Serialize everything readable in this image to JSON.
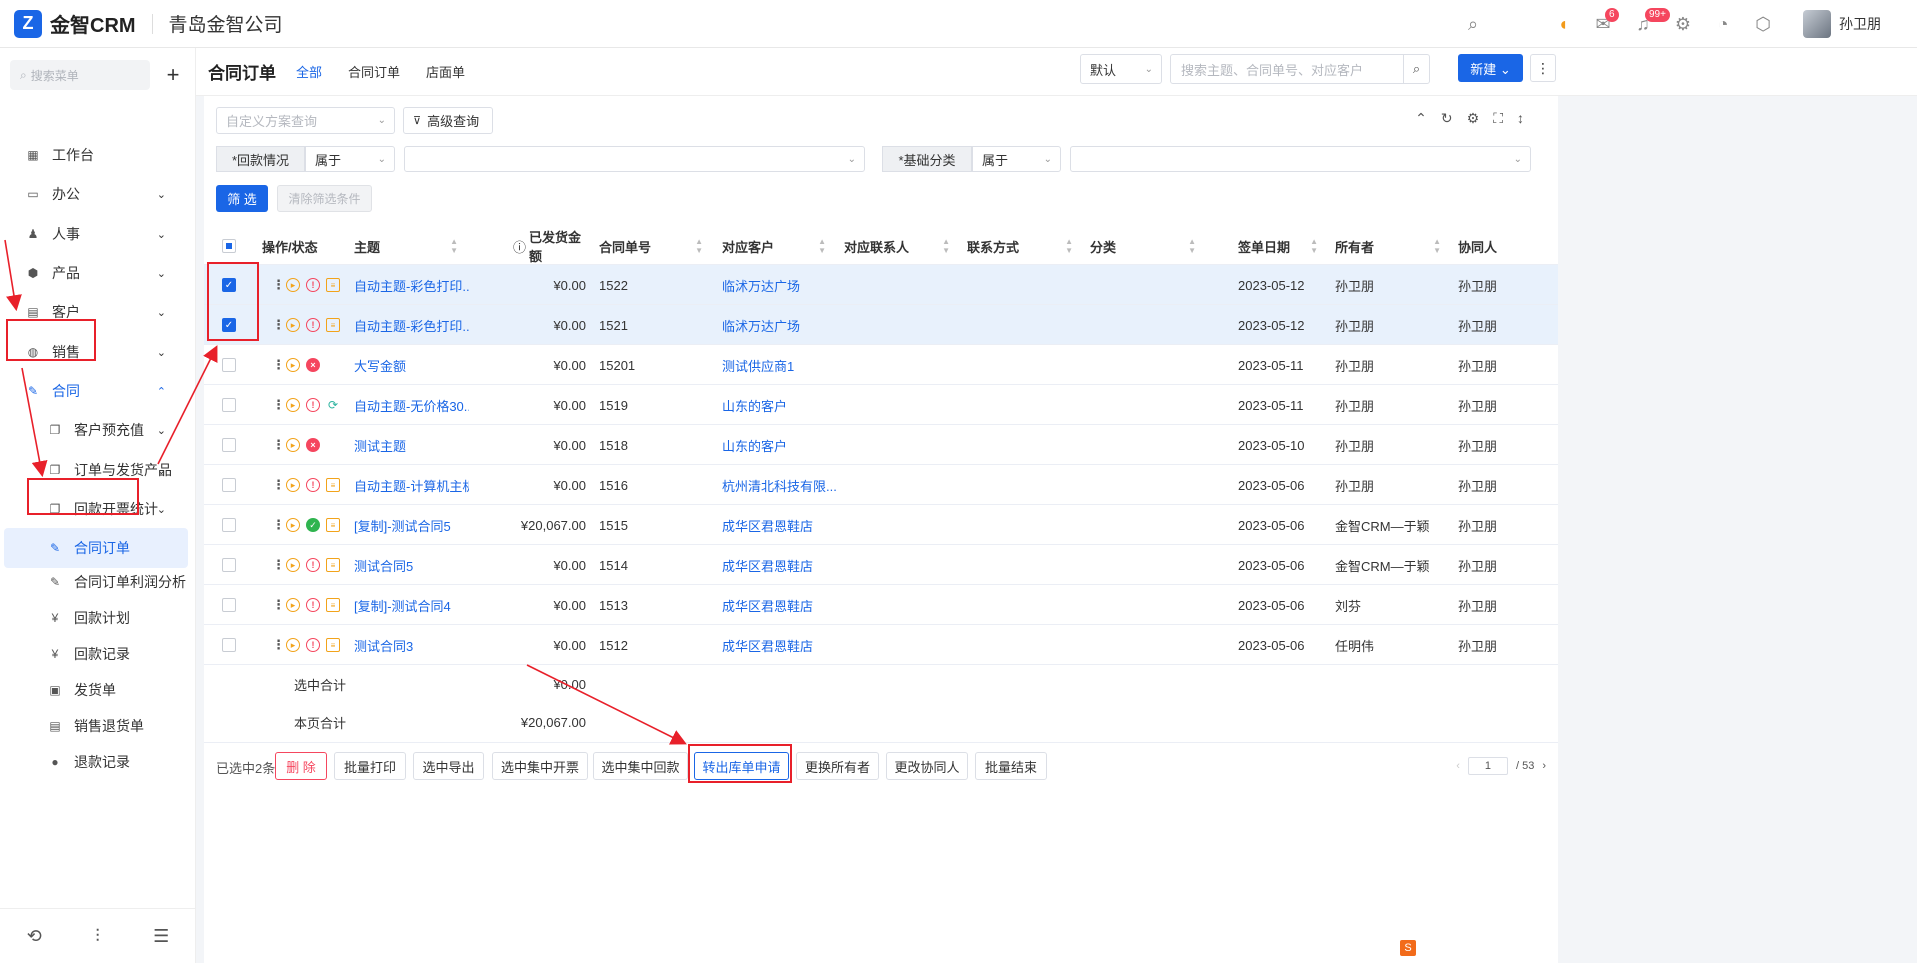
{
  "app": {
    "logo": "金智CRM",
    "company": "青岛金智公司",
    "user": "孙卫朋"
  },
  "top_icons": [
    {
      "name": "search-icon",
      "glyph": "⌕"
    },
    {
      "name": "speaker-icon",
      "glyph": "◖"
    },
    {
      "name": "inbox-icon",
      "glyph": "✉",
      "badge": "6"
    },
    {
      "name": "bell-icon",
      "glyph": "♫",
      "badge": "99+"
    },
    {
      "name": "settings-icon",
      "glyph": "⚙"
    },
    {
      "name": "chart-icon",
      "glyph": "◔"
    },
    {
      "name": "cube-icon",
      "glyph": "⬡"
    }
  ],
  "sidebar": {
    "search_placeholder": "搜索菜单",
    "items": [
      {
        "label": "工作台",
        "icon": "▦"
      },
      {
        "label": "办公",
        "icon": "▭",
        "chev": "⌄"
      },
      {
        "label": "人事",
        "icon": "♟",
        "chev": "⌄"
      },
      {
        "label": "产品",
        "icon": "⬢",
        "chev": "⌄"
      },
      {
        "label": "客户",
        "icon": "▤",
        "chev": "⌄"
      },
      {
        "label": "销售",
        "icon": "◍",
        "chev": "⌄"
      },
      {
        "label": "合同",
        "icon": "✎",
        "chev": "⌃"
      }
    ],
    "sub_items": [
      {
        "label": "客户预充值",
        "icon": "❐",
        "chev": "⌄"
      },
      {
        "label": "订单与发货产品",
        "icon": "❐",
        "chev": "⌄"
      },
      {
        "label": "回款开票统计",
        "icon": "❐",
        "chev": "⌄"
      },
      {
        "label": "合同订单",
        "icon": "✎"
      },
      {
        "label": "合同订单利润分析",
        "icon": "✎"
      },
      {
        "label": "回款计划",
        "icon": "¥"
      },
      {
        "label": "回款记录",
        "icon": "¥"
      },
      {
        "label": "发货单",
        "icon": "▣"
      },
      {
        "label": "销售退货单",
        "icon": "▤"
      },
      {
        "label": "退款记录",
        "icon": "●"
      }
    ]
  },
  "page": {
    "title": "合同订单",
    "tabs": [
      "全部",
      "合同订单",
      "店面单"
    ],
    "view_select": "默认",
    "search_placeholder": "搜索主题、合同单号、对应客户",
    "new_label": "新建 ⌄",
    "more_label": "⋮"
  },
  "filters": {
    "scheme_placeholder": "自定义方案查询",
    "advanced": "高级查询",
    "f1_label": "*回款情况",
    "f1_op": "属于",
    "f2_label": "*基础分类",
    "f2_op": "属于",
    "filter_btn": "筛 选",
    "clear_btn": "清除筛选条件"
  },
  "table": {
    "headers": [
      "操作/状态",
      "主题",
      "已发货金额",
      "合同单号",
      "对应客户",
      "对应联系人",
      "联系方式",
      "分类",
      "签单日期",
      "所有者",
      "协同人"
    ],
    "rows": [
      {
        "checked": true,
        "status": "warn",
        "third": "doc",
        "subject": "自动主题-彩色打印...",
        "amount": "¥0.00",
        "no": "1522",
        "customer": "临沭万达广场",
        "date": "2023-05-12",
        "owner": "孙卫朋",
        "co": "孙卫朋"
      },
      {
        "checked": true,
        "status": "warn",
        "third": "doc",
        "subject": "自动主题-彩色打印...",
        "amount": "¥0.00",
        "no": "1521",
        "customer": "临沭万达广场",
        "date": "2023-05-12",
        "owner": "孙卫朋",
        "co": "孙卫朋"
      },
      {
        "checked": false,
        "status": "err",
        "third": "",
        "subject": "大写金额",
        "amount": "¥0.00",
        "no": "15201",
        "customer": "测试供应商1",
        "date": "2023-05-11",
        "owner": "孙卫朋",
        "co": "孙卫朋"
      },
      {
        "checked": false,
        "status": "warn",
        "third": "sync",
        "subject": "自动主题-无价格30...",
        "amount": "¥0.00",
        "no": "1519",
        "customer": "山东的客户",
        "date": "2023-05-11",
        "owner": "孙卫朋",
        "co": "孙卫朋"
      },
      {
        "checked": false,
        "status": "err",
        "third": "",
        "subject": "测试主题",
        "amount": "¥0.00",
        "no": "1518",
        "customer": "山东的客户",
        "date": "2023-05-10",
        "owner": "孙卫朋",
        "co": "孙卫朋"
      },
      {
        "checked": false,
        "status": "warn",
        "third": "doc",
        "subject": "自动主题-计算机主机",
        "amount": "¥0.00",
        "no": "1516",
        "customer": "杭州清北科技有限...",
        "date": "2023-05-06",
        "owner": "孙卫朋",
        "co": "孙卫朋"
      },
      {
        "checked": false,
        "status": "ok",
        "third": "doc",
        "subject": "[复制]-测试合同5",
        "amount": "¥20,067.00",
        "no": "1515",
        "customer": "成华区君恩鞋店",
        "date": "2023-05-06",
        "owner": "金智CRM—于颖",
        "co": "孙卫朋"
      },
      {
        "checked": false,
        "status": "warn",
        "third": "doc",
        "subject": "测试合同5",
        "amount": "¥0.00",
        "no": "1514",
        "customer": "成华区君恩鞋店",
        "date": "2023-05-06",
        "owner": "金智CRM—于颖",
        "co": "孙卫朋"
      },
      {
        "checked": false,
        "status": "warn",
        "third": "doc",
        "subject": "[复制]-测试合同4",
        "amount": "¥0.00",
        "no": "1513",
        "customer": "成华区君恩鞋店",
        "date": "2023-05-06",
        "owner": "刘芬",
        "co": "孙卫朋"
      },
      {
        "checked": false,
        "status": "warn",
        "third": "doc",
        "subject": "测试合同3",
        "amount": "¥0.00",
        "no": "1512",
        "customer": "成华区君恩鞋店",
        "date": "2023-05-06",
        "owner": "任明伟",
        "co": "孙卫朋"
      }
    ],
    "sum_selected_label": "选中合计",
    "sum_selected": "¥0.00",
    "sum_page_label": "本页合计",
    "sum_page": "¥20,067.00"
  },
  "bottom": {
    "selected_text": "已选中2条",
    "buttons": [
      "删 除",
      "批量打印",
      "选中导出",
      "选中集中开票",
      "选中集中回款",
      "转出库单申请",
      "更换所有者",
      "更改协同人",
      "批量结束"
    ],
    "page_current": "1",
    "page_total": "/ 53"
  },
  "annotation_color": "#e8202a"
}
